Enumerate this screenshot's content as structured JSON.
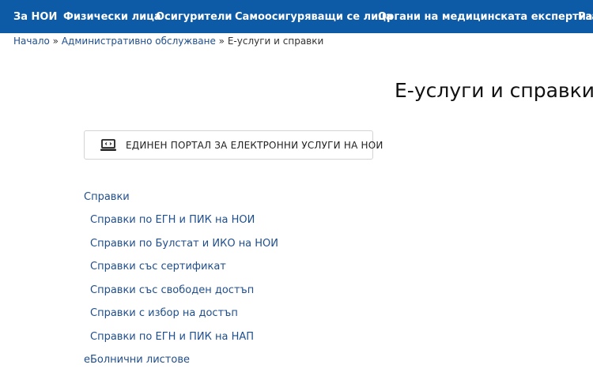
{
  "nav": {
    "items": [
      "За НОИ",
      "Физически лица",
      "Осигурители",
      "Самоосигуряващи се лица",
      "Органи на медицинската експертиза",
      "Раз"
    ]
  },
  "breadcrumb": {
    "home": "Начало",
    "separator": "»",
    "parent": "Административно обслужване",
    "current": "Е-услуги и справки"
  },
  "page": {
    "title": "Е-услуги и справки"
  },
  "portal_button": {
    "icon": "laptop-icon",
    "label": "ЕДИНЕН ПОРТАЛ ЗА ЕЛЕКТРОННИ УСЛУГИ НА НОИ"
  },
  "sections": {
    "spravki": {
      "title": "Справки",
      "items": [
        "Справки по ЕГН и ПИК на НОИ",
        "Справки по Булстат и ИКО на НОИ",
        "Справки със сертификат",
        "Справки със свободен достъп",
        "Справки с избор на достъп",
        "Справки по ЕГН и ПИК на НАП"
      ]
    },
    "ebolnichni": {
      "title": "еБолнични листове"
    }
  },
  "colors": {
    "nav_background": "#0d5aa7",
    "link": "#1f4e8c"
  }
}
